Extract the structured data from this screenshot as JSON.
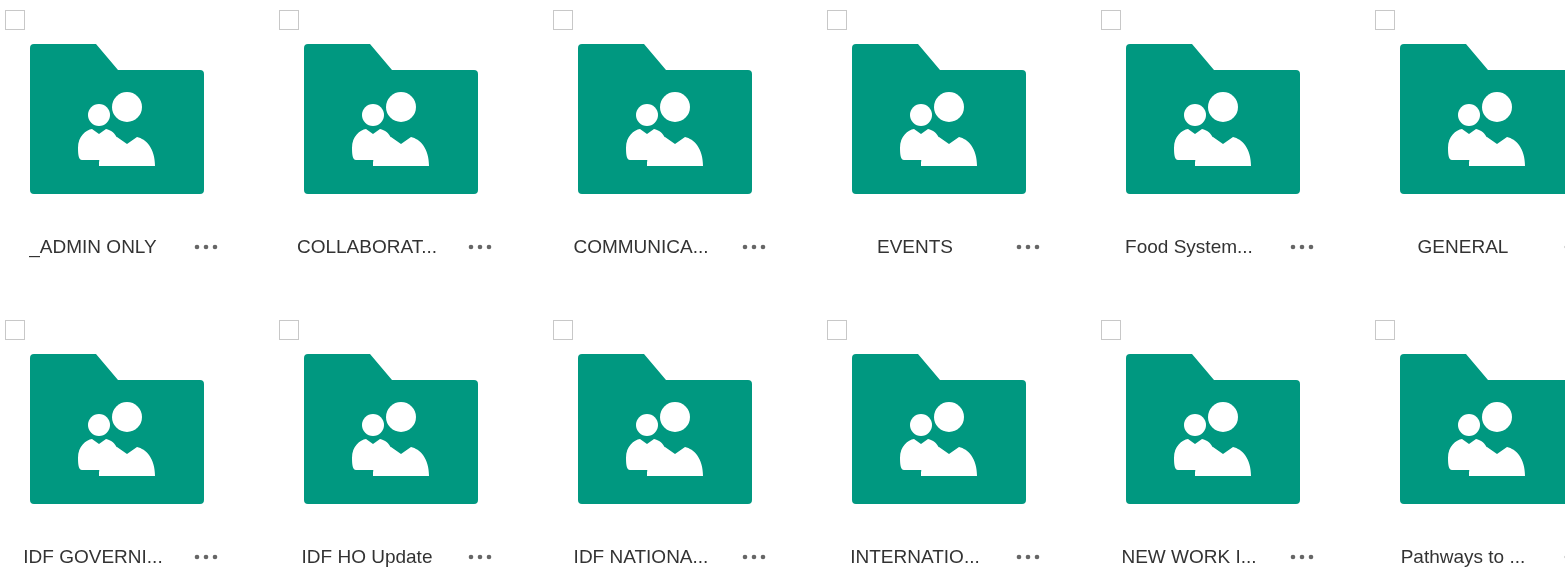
{
  "folders": [
    {
      "name": "_ADMIN ONLY",
      "checked": false
    },
    {
      "name": "COLLABORAT...",
      "checked": false
    },
    {
      "name": "COMMUNICA...",
      "checked": false
    },
    {
      "name": "EVENTS",
      "checked": false
    },
    {
      "name": "Food System...",
      "checked": false
    },
    {
      "name": "GENERAL",
      "checked": false
    },
    {
      "name": "IDF GOVERNI...",
      "checked": false
    },
    {
      "name": "IDF HO Update",
      "checked": false
    },
    {
      "name": "IDF NATIONA...",
      "checked": false
    },
    {
      "name": "INTERNATIO...",
      "checked": false
    },
    {
      "name": "NEW WORK I...",
      "checked": false
    },
    {
      "name": "Pathways to ...",
      "checked": false
    }
  ]
}
